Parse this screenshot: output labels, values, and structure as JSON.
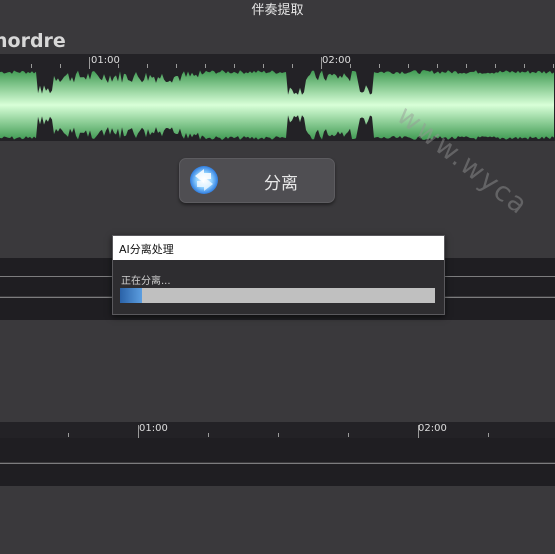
{
  "window": {
    "title": "伴奏提取"
  },
  "track": {
    "name": "nordre"
  },
  "top_ruler": {
    "labels": [
      "01:00",
      "02:00"
    ]
  },
  "separate_button": {
    "label": "分离",
    "icon": "separate-icon"
  },
  "dialog": {
    "title": "AI分离处理",
    "status": "正在分离...",
    "progress": 0.07
  },
  "bottom_ruler": {
    "labels": [
      "01:00",
      "02:00"
    ]
  },
  "watermark": {
    "text": "www.wyca"
  },
  "colors": {
    "waveform": "#7fe08c",
    "progress": "#3e7fc8",
    "background": "#3a393c"
  }
}
